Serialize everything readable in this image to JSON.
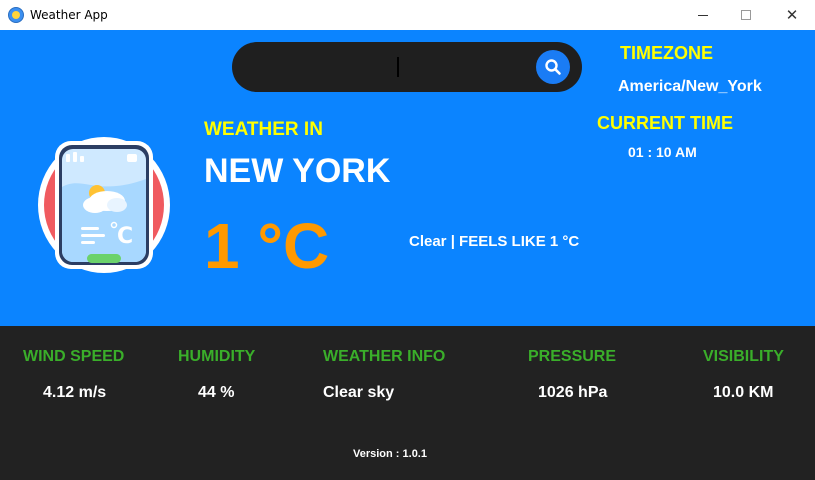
{
  "window": {
    "title": "Weather App",
    "minimize_icon": "minimize-icon",
    "maximize_icon": "maximize-icon",
    "close_icon": "close-icon",
    "close_glyph": "✕"
  },
  "search": {
    "value": "",
    "button_icon": "search-icon"
  },
  "timezone": {
    "label": "TIMEZONE",
    "value": "America/New_York"
  },
  "current_time": {
    "label": "CURRENT TIME",
    "value": "01 : 10 AM"
  },
  "weather": {
    "icon": "weather-app-logo-icon",
    "heading": "WEATHER IN",
    "city": "NEW YORK",
    "temperature": "1 °C",
    "description": "Clear | FEELS LIKE 1 °C"
  },
  "stats": {
    "wind": {
      "label": "WIND SPEED",
      "value": "4.12 m/s"
    },
    "humidity": {
      "label": "HUMIDITY",
      "value": "44 %"
    },
    "info": {
      "label": "WEATHER INFO",
      "value": "Clear sky"
    },
    "pressure": {
      "label": "PRESSURE",
      "value": "1026 hPa"
    },
    "visibility": {
      "label": "VISIBILITY",
      "value": "10.0 KM"
    }
  },
  "version": "Version : 1.0.1",
  "colors": {
    "panel_blue": "#0b84ff",
    "panel_dark": "#222222",
    "label_yellow": "#ffff00",
    "temp_orange": "#ff9900",
    "stat_green": "#3aae2a",
    "search_button": "#1a7cf5"
  }
}
